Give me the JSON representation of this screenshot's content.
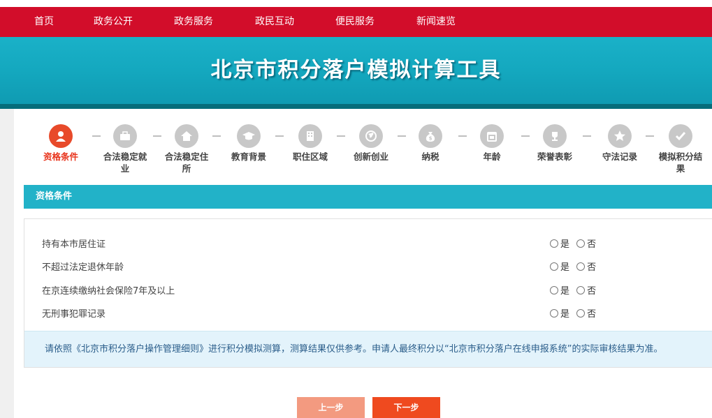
{
  "nav": {
    "items": [
      "首页",
      "政务公开",
      "政务服务",
      "政民互动",
      "便民服务",
      "新闻速览"
    ]
  },
  "banner": {
    "title": "北京市积分落户模拟计算工具"
  },
  "steps": [
    {
      "label": "资格条件",
      "icon": "person-icon",
      "active": true
    },
    {
      "label": "合法稳定就业",
      "icon": "briefcase-icon",
      "active": false
    },
    {
      "label": "合法稳定住所",
      "icon": "house-icon",
      "active": false
    },
    {
      "label": "教育背景",
      "icon": "graduation-cap-icon",
      "active": false
    },
    {
      "label": "职住区域",
      "icon": "building-icon",
      "active": false
    },
    {
      "label": "创新创业",
      "icon": "globe-icon",
      "active": false
    },
    {
      "label": "纳税",
      "icon": "money-bag-icon",
      "active": false
    },
    {
      "label": "年龄",
      "icon": "calendar-icon",
      "active": false
    },
    {
      "label": "荣誉表彰",
      "icon": "trophy-icon",
      "active": false
    },
    {
      "label": "守法记录",
      "icon": "star-icon",
      "active": false
    },
    {
      "label": "模拟积分结果",
      "icon": "checkmark-icon",
      "active": false
    }
  ],
  "section": {
    "title": "资格条件"
  },
  "questions": [
    {
      "text": "持有本市居住证",
      "yes": "是",
      "no": "否"
    },
    {
      "text": "不超过法定退休年龄",
      "yes": "是",
      "no": "否"
    },
    {
      "text": "在京连续缴纳社会保险7年及以上",
      "yes": "是",
      "no": "否"
    },
    {
      "text": "无刑事犯罪记录",
      "yes": "是",
      "no": "否"
    }
  ],
  "notice": "请依照《北京市积分落户操作管理细则》进行积分模拟测算，测算结果仅供参考。申请人最终积分以“北京市积分落户在线申报系统”的实际审核结果为准。",
  "buttons": {
    "prev": "上一步",
    "next": "下一步"
  },
  "colors": {
    "nav": "#d20d2a",
    "banner": "#14a8bf",
    "accent": "#ef4a1f",
    "step_inactive": "#c8c8c8"
  }
}
